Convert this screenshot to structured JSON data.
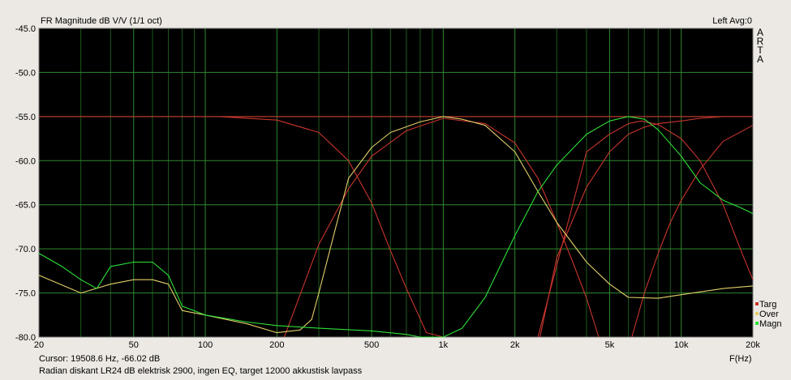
{
  "window": {
    "title": "FR Magnitude dB V/V (1/1 oct)",
    "channel": "Left  Avg:0",
    "brand": [
      "A",
      "R",
      "T",
      "A"
    ],
    "x_unit": "F(Hz)",
    "cursor": "Cursor: 19508.6 Hz, -66.02 dB",
    "caption": "Radian diskant LR24 dB elektrisk 2900, ingen EQ, target 12000 akkustisk lavpass"
  },
  "colors": {
    "background": "#000000",
    "grid_major": "#2f8a2f",
    "grid_minor": "#1c5a1c",
    "targ": "#c8352e",
    "over": "#e3cf6a",
    "magn": "#2ee03a"
  },
  "chart_data": {
    "type": "line",
    "title": "FR Magnitude dB V/V (1/1 oct)",
    "xlabel": "F(Hz)",
    "ylabel": "",
    "x_scale": "log",
    "xlim": [
      20,
      20000
    ],
    "ylim": [
      -80,
      -45
    ],
    "grid": true,
    "legend_position": "bottom-right",
    "x_ticks": [
      20,
      50,
      100,
      200,
      500,
      1000,
      2000,
      5000,
      10000,
      20000
    ],
    "x_tick_labels": [
      "20",
      "50",
      "100",
      "200",
      "500",
      "1k",
      "2k",
      "5k",
      "10k",
      "20k"
    ],
    "y_ticks": [
      -45,
      -50,
      -55,
      -60,
      -65,
      -70,
      -75,
      -80
    ],
    "y_tick_labels": [
      "-45.0",
      "-50.0",
      "-55.0",
      "-60.0",
      "-65.0",
      "-70.0",
      "-75.0",
      "-80.0"
    ],
    "series": [
      {
        "name": "Targ",
        "key": "targ",
        "color": "#c8352e",
        "x": [
          20,
          20000
        ],
        "y": [
          -55.0,
          -55.0
        ]
      },
      {
        "name": "Targ",
        "key": "targ",
        "color": "#c8352e",
        "x": [
          115,
          200,
          300,
          400,
          500,
          600,
          700,
          850,
          1000
        ],
        "y": [
          -55.0,
          -55.4,
          -56.8,
          -60.0,
          -64.8,
          -70.2,
          -74.5,
          -79.5,
          -80.0
        ]
      },
      {
        "name": "Targ",
        "key": "targ",
        "color": "#c8352e",
        "x": [
          215,
          300,
          400,
          500,
          700,
          1000,
          1500,
          2000,
          2500,
          3000,
          3500,
          4000,
          4500
        ],
        "y": [
          -80.0,
          -69.5,
          -63.2,
          -59.5,
          -56.6,
          -55.2,
          -55.8,
          -58.0,
          -62.0,
          -67.0,
          -71.5,
          -75.6,
          -80.0
        ]
      },
      {
        "name": "Targ",
        "key": "targ",
        "color": "#c8352e",
        "x": [
          2550,
          3000,
          4000,
          5000,
          6000,
          7000,
          8000,
          10000,
          12000,
          15000,
          20000
        ],
        "y": [
          -80.0,
          -71.0,
          -63.0,
          -59.0,
          -57.0,
          -56.2,
          -55.8,
          -55.5,
          -55.2,
          -55.0,
          -55.0
        ]
      },
      {
        "name": "Targ",
        "key": "targ",
        "color": "#c8352e",
        "x": [
          2500,
          4000,
          5000,
          6000,
          6800,
          8000,
          10000,
          12000,
          15000,
          18000,
          20000
        ],
        "y": [
          -80.0,
          -59.0,
          -57.0,
          -55.8,
          -55.5,
          -55.9,
          -57.5,
          -60.0,
          -65.0,
          -70.5,
          -73.5
        ]
      },
      {
        "name": "Targ",
        "key": "targ",
        "color": "#c8352e",
        "x": [
          6200,
          7000,
          8000,
          9000,
          10000,
          12000,
          15000,
          20000
        ],
        "y": [
          -80.0,
          -75.0,
          -70.5,
          -67.0,
          -64.5,
          -61.0,
          -57.8,
          -56.0
        ]
      },
      {
        "name": "Over",
        "key": "over",
        "color": "#e3cf6a",
        "x": [
          20,
          30,
          40,
          50,
          60,
          70,
          80,
          100,
          150,
          200,
          250,
          280,
          300,
          350,
          400,
          500,
          600,
          800,
          1000,
          1200,
          1500,
          2000,
          2500,
          3000,
          4000,
          5000,
          6000,
          8000,
          10000,
          15000,
          20000
        ],
        "y": [
          -73.0,
          -75.0,
          -74.0,
          -73.5,
          -73.5,
          -74.0,
          -77.0,
          -77.5,
          -78.5,
          -79.5,
          -79.2,
          -78.0,
          -75.0,
          -68.0,
          -62.0,
          -58.5,
          -56.8,
          -55.6,
          -55.0,
          -55.3,
          -56.0,
          -59.0,
          -63.5,
          -67.0,
          -71.5,
          -74.0,
          -75.5,
          -75.6,
          -75.2,
          -74.5,
          -74.2
        ]
      },
      {
        "name": "Magn",
        "key": "magn",
        "color": "#2ee03a",
        "x": [
          20,
          25,
          30,
          35,
          40,
          50,
          60,
          70,
          80,
          100,
          150,
          200,
          300,
          500,
          700,
          800,
          1000,
          1200,
          1500,
          2000,
          2500,
          3000,
          4000,
          5000,
          6000,
          7000,
          8000,
          10000,
          12000,
          15000,
          18000,
          20000
        ],
        "y": [
          -70.5,
          -72.0,
          -73.5,
          -74.5,
          -72.0,
          -71.5,
          -71.5,
          -73.0,
          -76.5,
          -77.5,
          -78.3,
          -78.7,
          -79.0,
          -79.3,
          -79.7,
          -80.0,
          -80.0,
          -79.0,
          -75.5,
          -68.5,
          -63.5,
          -60.5,
          -57.0,
          -55.5,
          -55.0,
          -55.3,
          -56.5,
          -59.5,
          -62.5,
          -64.5,
          -65.4,
          -66.0
        ]
      }
    ],
    "legend": [
      {
        "label": "Targ",
        "color": "#c8352e"
      },
      {
        "label": "Over",
        "color": "#e3cf6a"
      },
      {
        "label": "Magn",
        "color": "#2ee03a"
      }
    ]
  }
}
